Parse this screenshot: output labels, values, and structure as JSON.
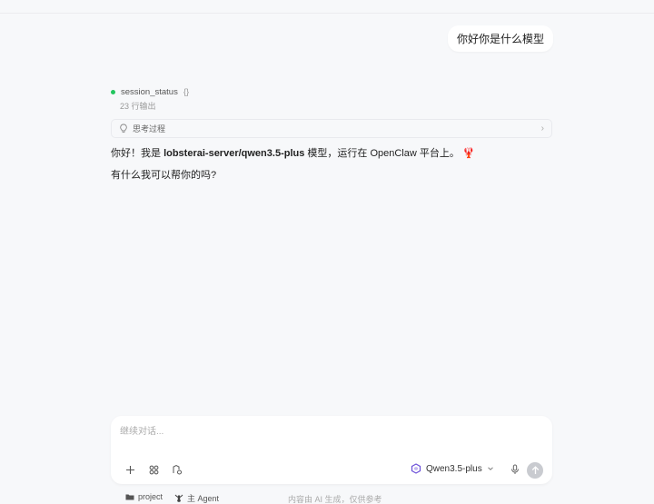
{
  "conversation": {
    "user_message": "你好你是什么模型",
    "tool_call": {
      "name": "session_status",
      "params": "{}",
      "output_summary": "23 行输出",
      "status_color": "#22c55e"
    },
    "thinking_label": "思考过程",
    "assistant": {
      "line1_prefix": "你好！我是 ",
      "line1_model": "lobsterai-server/qwen3.5-plus",
      "line1_suffix": " 模型，运行在 OpenClaw 平台上。",
      "line1_emoji": "🦞",
      "line2": "有什么我可以帮你的吗?"
    }
  },
  "composer": {
    "placeholder": "继续对话...",
    "value": "",
    "model_name": "Qwen3.5-plus",
    "tools": [
      "plus-icon",
      "apps-icon",
      "skills-icon"
    ]
  },
  "footer": {
    "project_label": "project",
    "agent_label": "主 Agent",
    "disclaimer": "内容由 AI 生成，仅供参考"
  }
}
